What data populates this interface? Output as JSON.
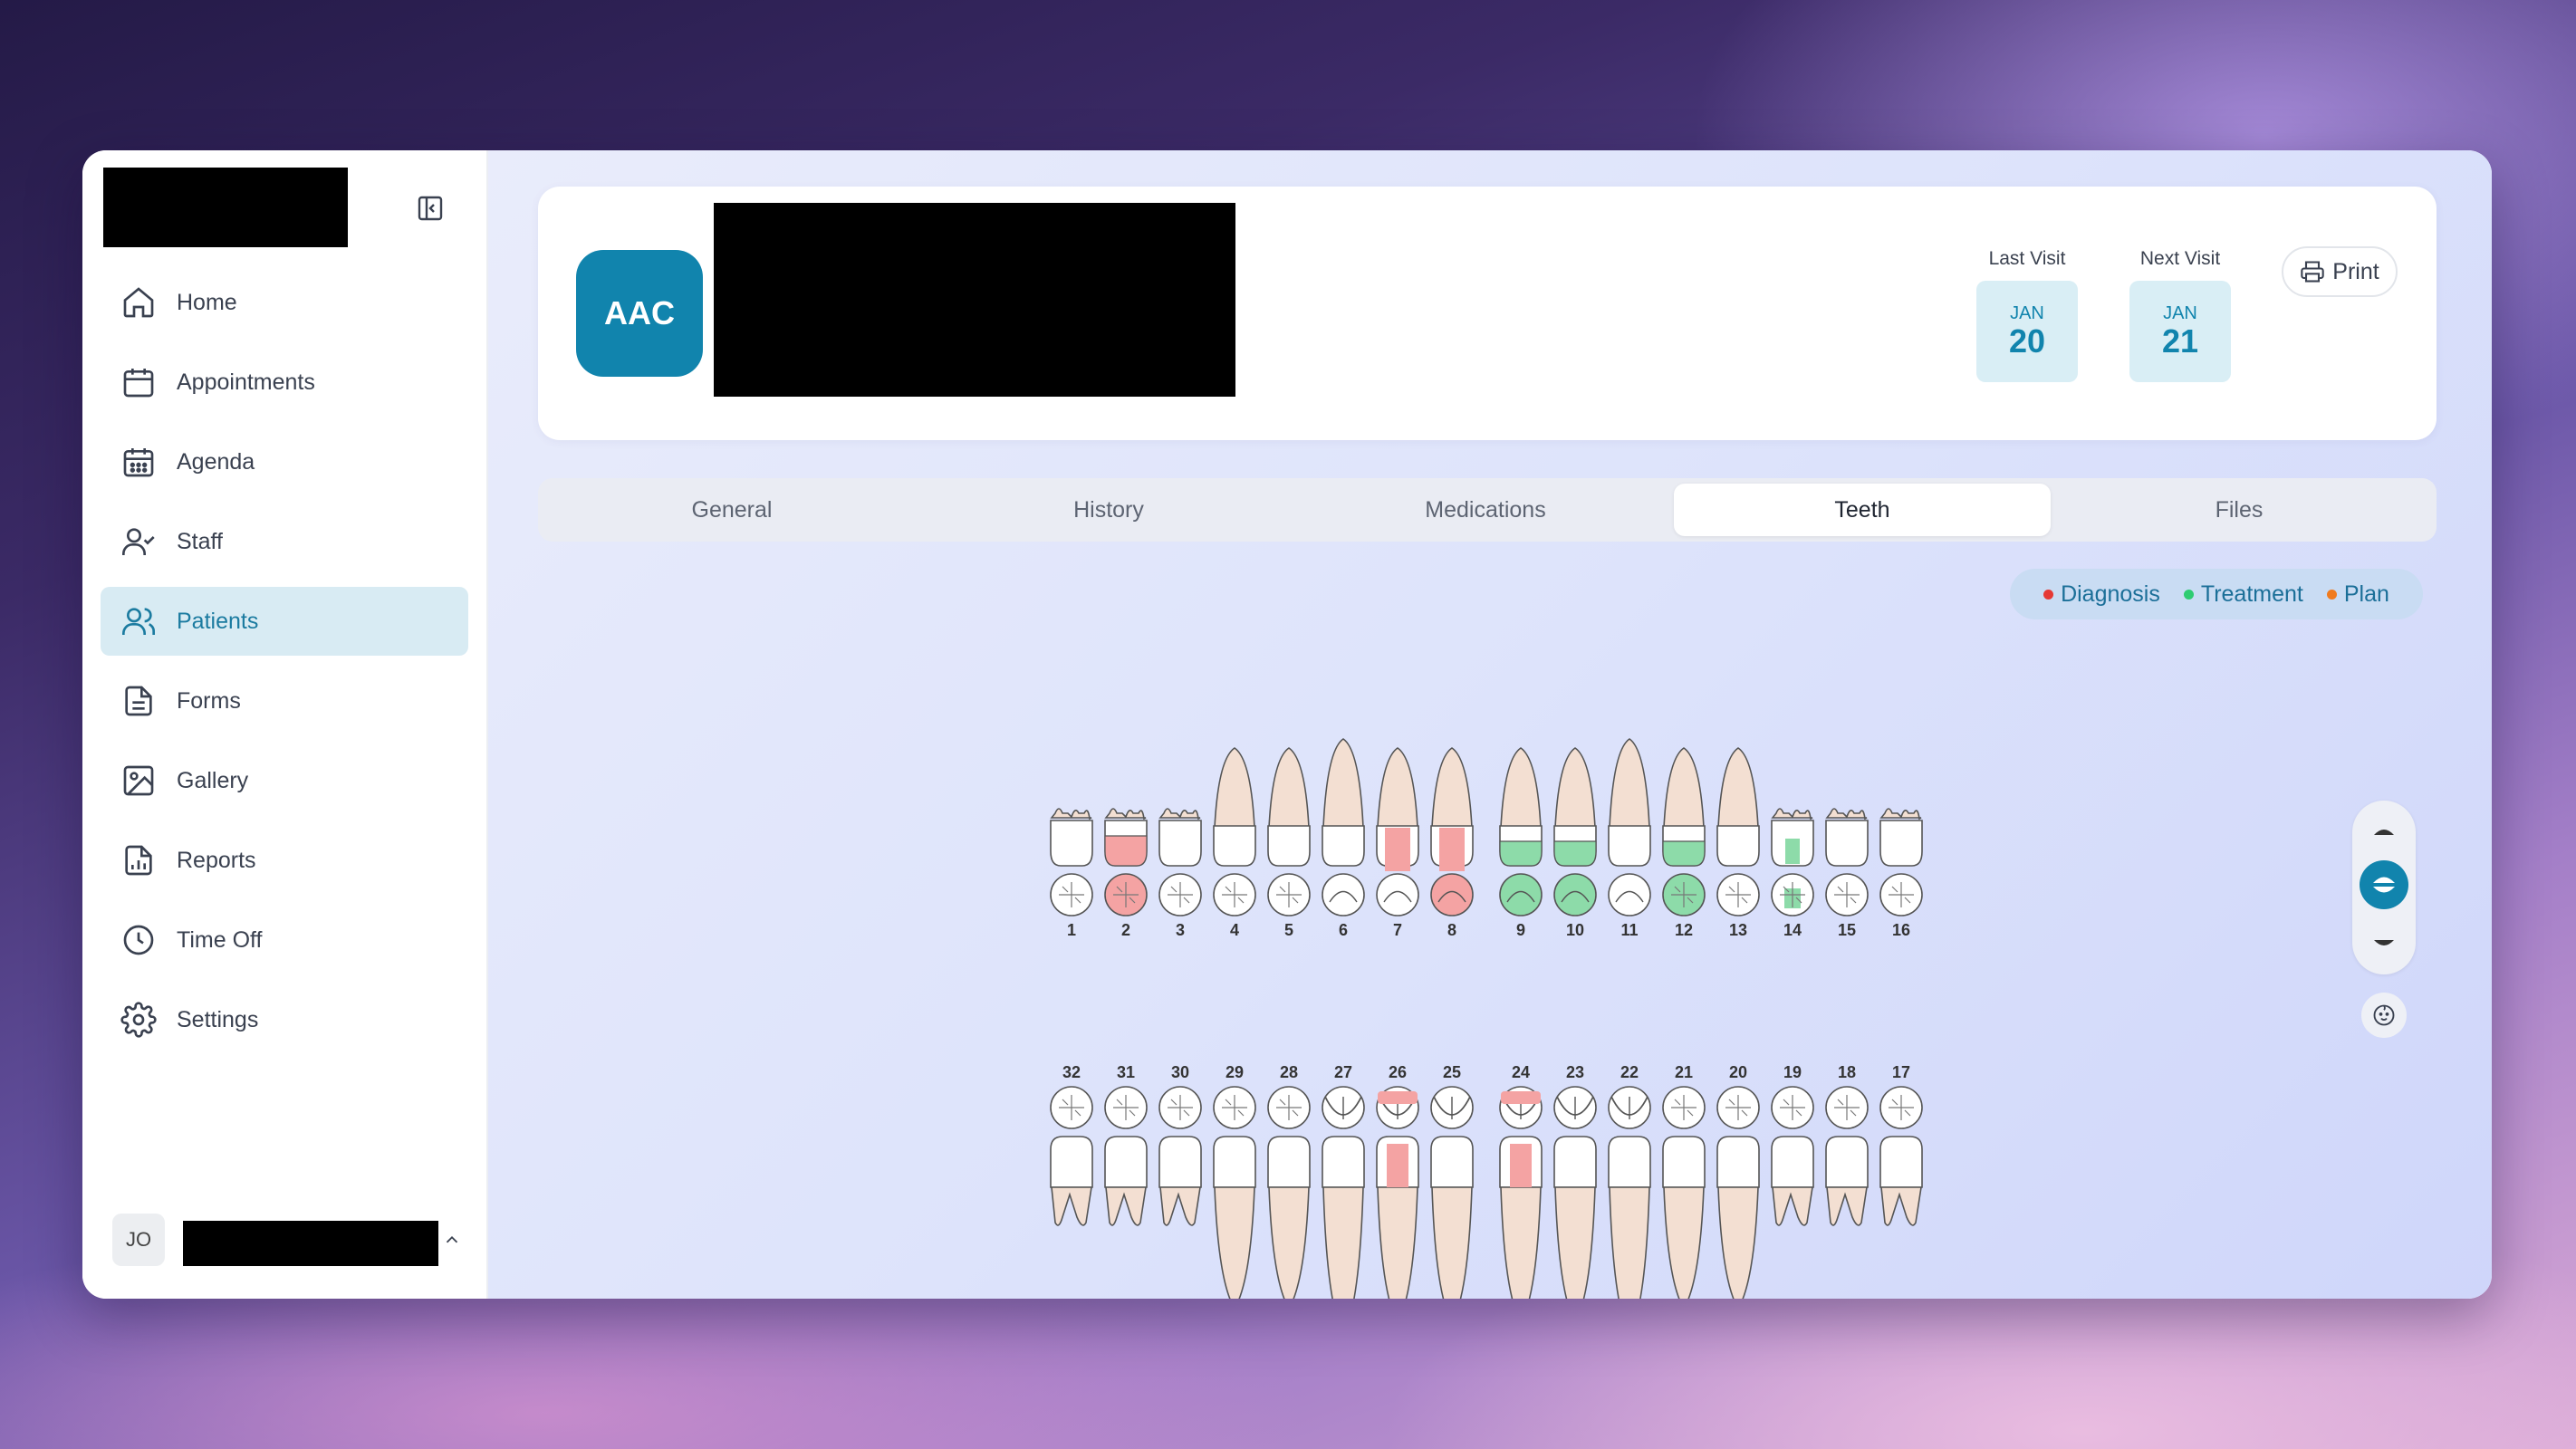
{
  "sidebar": {
    "items": [
      {
        "label": "Home",
        "icon": "home-icon"
      },
      {
        "label": "Appointments",
        "icon": "calendar-icon"
      },
      {
        "label": "Agenda",
        "icon": "calendar-grid-icon"
      },
      {
        "label": "Staff",
        "icon": "user-check-icon"
      },
      {
        "label": "Patients",
        "icon": "users-icon",
        "active": true
      },
      {
        "label": "Forms",
        "icon": "file-text-icon"
      },
      {
        "label": "Gallery",
        "icon": "image-icon"
      },
      {
        "label": "Reports",
        "icon": "file-chart-icon"
      },
      {
        "label": "Time Off",
        "icon": "clock-icon"
      },
      {
        "label": "Settings",
        "icon": "gear-icon"
      }
    ],
    "user": {
      "initials": "JO"
    }
  },
  "patient": {
    "initials": "AAC",
    "last_visit": {
      "label": "Last Visit",
      "month": "JAN",
      "day": "20"
    },
    "next_visit": {
      "label": "Next Visit",
      "month": "JAN",
      "day": "21"
    },
    "print_label": "Print"
  },
  "tabs": [
    {
      "label": "General"
    },
    {
      "label": "History"
    },
    {
      "label": "Medications"
    },
    {
      "label": "Teeth",
      "active": true
    },
    {
      "label": "Files"
    }
  ],
  "legend": [
    {
      "label": "Diagnosis",
      "color": "#e53935"
    },
    {
      "label": "Treatment",
      "color": "#2ecc71"
    },
    {
      "label": "Plan",
      "color": "#f07b1e"
    }
  ],
  "colors": {
    "accent": "#1184ad",
    "diagnosis": "#f4a3a3",
    "treatment": "#8ddba9",
    "tooth_root": "#f3dfd2"
  },
  "teeth": {
    "upper": [
      "1",
      "2",
      "3",
      "4",
      "5",
      "6",
      "7",
      "8",
      "9",
      "10",
      "11",
      "12",
      "13",
      "14",
      "15",
      "16"
    ],
    "lower": [
      "32",
      "31",
      "30",
      "29",
      "28",
      "27",
      "26",
      "25",
      "24",
      "23",
      "22",
      "21",
      "20",
      "19",
      "18",
      "17"
    ],
    "marked": {
      "2": "diagnosis",
      "7": "diagnosis",
      "8": "diagnosis",
      "9": "treatment",
      "10": "treatment",
      "12": "treatment",
      "14": "treatment",
      "26": "diagnosis",
      "24": "diagnosis"
    }
  }
}
